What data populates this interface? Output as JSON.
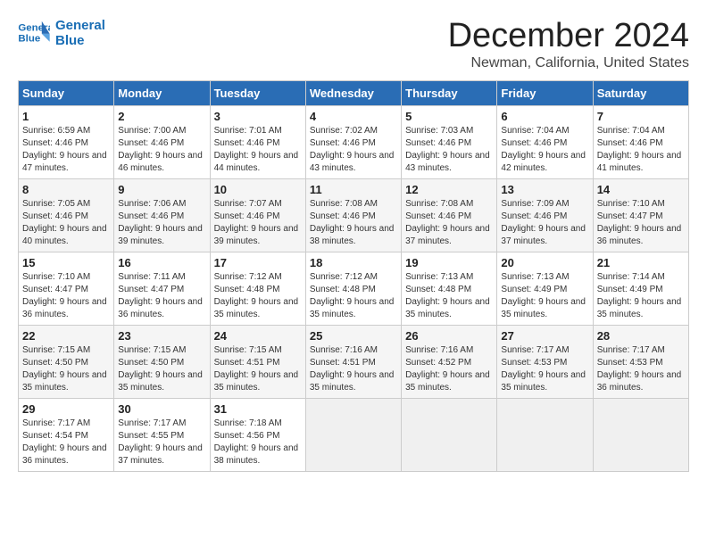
{
  "logo": {
    "line1": "General",
    "line2": "Blue"
  },
  "title": "December 2024",
  "subtitle": "Newman, California, United States",
  "weekdays": [
    "Sunday",
    "Monday",
    "Tuesday",
    "Wednesday",
    "Thursday",
    "Friday",
    "Saturday"
  ],
  "weeks": [
    [
      {
        "day": "1",
        "sunrise": "6:59 AM",
        "sunset": "4:46 PM",
        "daylight": "9 hours and 47 minutes."
      },
      {
        "day": "2",
        "sunrise": "7:00 AM",
        "sunset": "4:46 PM",
        "daylight": "9 hours and 46 minutes."
      },
      {
        "day": "3",
        "sunrise": "7:01 AM",
        "sunset": "4:46 PM",
        "daylight": "9 hours and 44 minutes."
      },
      {
        "day": "4",
        "sunrise": "7:02 AM",
        "sunset": "4:46 PM",
        "daylight": "9 hours and 43 minutes."
      },
      {
        "day": "5",
        "sunrise": "7:03 AM",
        "sunset": "4:46 PM",
        "daylight": "9 hours and 43 minutes."
      },
      {
        "day": "6",
        "sunrise": "7:04 AM",
        "sunset": "4:46 PM",
        "daylight": "9 hours and 42 minutes."
      },
      {
        "day": "7",
        "sunrise": "7:04 AM",
        "sunset": "4:46 PM",
        "daylight": "9 hours and 41 minutes."
      }
    ],
    [
      {
        "day": "8",
        "sunrise": "7:05 AM",
        "sunset": "4:46 PM",
        "daylight": "9 hours and 40 minutes."
      },
      {
        "day": "9",
        "sunrise": "7:06 AM",
        "sunset": "4:46 PM",
        "daylight": "9 hours and 39 minutes."
      },
      {
        "day": "10",
        "sunrise": "7:07 AM",
        "sunset": "4:46 PM",
        "daylight": "9 hours and 39 minutes."
      },
      {
        "day": "11",
        "sunrise": "7:08 AM",
        "sunset": "4:46 PM",
        "daylight": "9 hours and 38 minutes."
      },
      {
        "day": "12",
        "sunrise": "7:08 AM",
        "sunset": "4:46 PM",
        "daylight": "9 hours and 37 minutes."
      },
      {
        "day": "13",
        "sunrise": "7:09 AM",
        "sunset": "4:46 PM",
        "daylight": "9 hours and 37 minutes."
      },
      {
        "day": "14",
        "sunrise": "7:10 AM",
        "sunset": "4:47 PM",
        "daylight": "9 hours and 36 minutes."
      }
    ],
    [
      {
        "day": "15",
        "sunrise": "7:10 AM",
        "sunset": "4:47 PM",
        "daylight": "9 hours and 36 minutes."
      },
      {
        "day": "16",
        "sunrise": "7:11 AM",
        "sunset": "4:47 PM",
        "daylight": "9 hours and 36 minutes."
      },
      {
        "day": "17",
        "sunrise": "7:12 AM",
        "sunset": "4:48 PM",
        "daylight": "9 hours and 35 minutes."
      },
      {
        "day": "18",
        "sunrise": "7:12 AM",
        "sunset": "4:48 PM",
        "daylight": "9 hours and 35 minutes."
      },
      {
        "day": "19",
        "sunrise": "7:13 AM",
        "sunset": "4:48 PM",
        "daylight": "9 hours and 35 minutes."
      },
      {
        "day": "20",
        "sunrise": "7:13 AM",
        "sunset": "4:49 PM",
        "daylight": "9 hours and 35 minutes."
      },
      {
        "day": "21",
        "sunrise": "7:14 AM",
        "sunset": "4:49 PM",
        "daylight": "9 hours and 35 minutes."
      }
    ],
    [
      {
        "day": "22",
        "sunrise": "7:15 AM",
        "sunset": "4:50 PM",
        "daylight": "9 hours and 35 minutes."
      },
      {
        "day": "23",
        "sunrise": "7:15 AM",
        "sunset": "4:50 PM",
        "daylight": "9 hours and 35 minutes."
      },
      {
        "day": "24",
        "sunrise": "7:15 AM",
        "sunset": "4:51 PM",
        "daylight": "9 hours and 35 minutes."
      },
      {
        "day": "25",
        "sunrise": "7:16 AM",
        "sunset": "4:51 PM",
        "daylight": "9 hours and 35 minutes."
      },
      {
        "day": "26",
        "sunrise": "7:16 AM",
        "sunset": "4:52 PM",
        "daylight": "9 hours and 35 minutes."
      },
      {
        "day": "27",
        "sunrise": "7:17 AM",
        "sunset": "4:53 PM",
        "daylight": "9 hours and 35 minutes."
      },
      {
        "day": "28",
        "sunrise": "7:17 AM",
        "sunset": "4:53 PM",
        "daylight": "9 hours and 36 minutes."
      }
    ],
    [
      {
        "day": "29",
        "sunrise": "7:17 AM",
        "sunset": "4:54 PM",
        "daylight": "9 hours and 36 minutes."
      },
      {
        "day": "30",
        "sunrise": "7:17 AM",
        "sunset": "4:55 PM",
        "daylight": "9 hours and 37 minutes."
      },
      {
        "day": "31",
        "sunrise": "7:18 AM",
        "sunset": "4:56 PM",
        "daylight": "9 hours and 38 minutes."
      },
      null,
      null,
      null,
      null
    ]
  ],
  "labels": {
    "sunrise": "Sunrise:",
    "sunset": "Sunset:",
    "daylight": "Daylight:"
  }
}
